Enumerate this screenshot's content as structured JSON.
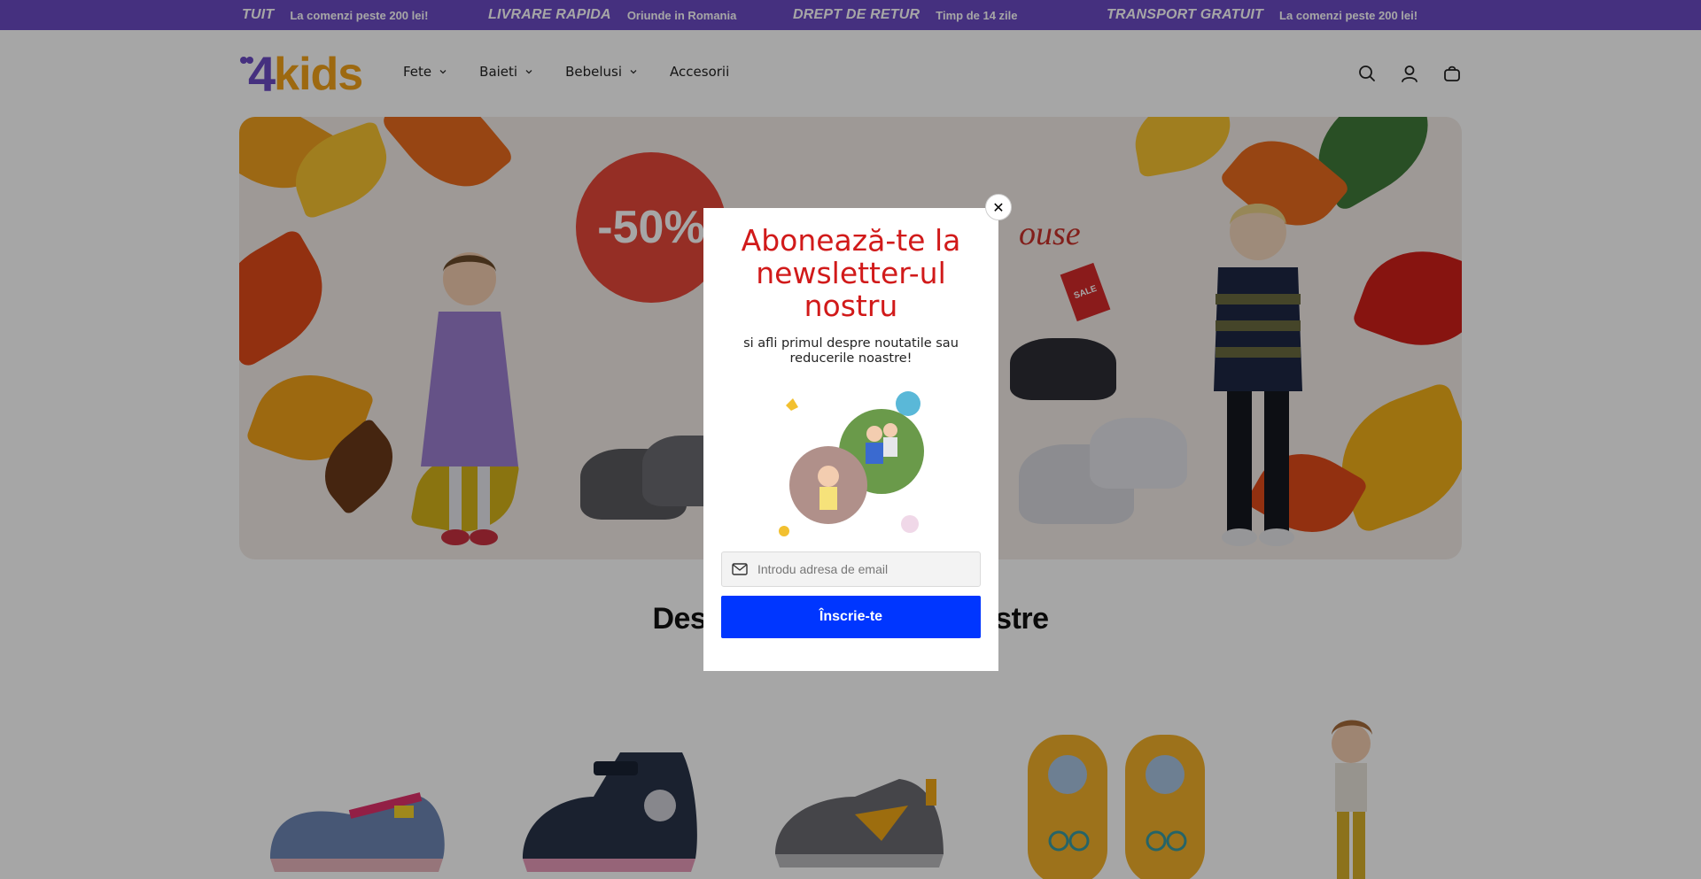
{
  "announcement": {
    "items": [
      {
        "title": "TUIT",
        "subtitle": "La comenzi peste 200 lei!"
      },
      {
        "title": "LIVRARE RAPIDA",
        "subtitle": "Oriunde in Romania"
      },
      {
        "title": "DREPT DE RETUR",
        "subtitle": "Timp de 14 zile"
      },
      {
        "title": "TRANSPORT GRATUIT",
        "subtitle": "La comenzi peste 200 lei!"
      }
    ],
    "background_color": "#6b4bc4"
  },
  "header": {
    "logo": {
      "part1": "4",
      "part2": "kids"
    },
    "nav": [
      {
        "label": "Fete",
        "has_dropdown": true
      },
      {
        "label": "Baieti",
        "has_dropdown": true
      },
      {
        "label": "Bebelusi",
        "has_dropdown": true
      },
      {
        "label": "Accesorii",
        "has_dropdown": false
      }
    ],
    "icons": [
      "search-icon",
      "account-icon",
      "cart-icon"
    ]
  },
  "hero": {
    "badge_text": "-50%",
    "tag_text": "SALE",
    "partial_text": "ouse"
  },
  "section": {
    "title": "Descopera colectiile noastre"
  },
  "products": [
    {
      "icon": "pink-canvas-shoe"
    },
    {
      "icon": "navy-swan-boot"
    },
    {
      "icon": "grey-yellow-sneaker"
    },
    {
      "icon": "yellow-bear-sandals"
    },
    {
      "icon": "girl-yellow-outfit"
    }
  ],
  "modal": {
    "title": "Abonează-te la newsletter-ul nostru",
    "subtitle": "si afli primul despre noutatile sau reducerile noastre!",
    "email_placeholder": "Introdu adresa de email",
    "email_value": "",
    "button_label": "Înscrie-te",
    "close_label": "✕",
    "title_color": "#d11a1a",
    "button_color": "#0036ff"
  }
}
